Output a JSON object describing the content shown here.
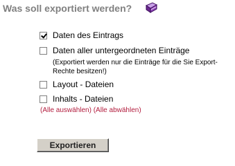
{
  "header": {
    "title": "Was soll exportiert werden?",
    "icon": "book-icon"
  },
  "options": [
    {
      "label": "Daten des Eintrags",
      "checked": true
    },
    {
      "label": "Daten aller untergeordneten Einträge",
      "checked": false
    },
    {
      "label": "Layout - Dateien",
      "checked": false
    },
    {
      "label": "Inhalts - Dateien",
      "checked": false
    }
  ],
  "note": "(Exportiert werden nur die Einträge für die Sie Export-Rechte besitzen!)",
  "links": {
    "select_all": "(Alle auswählen)",
    "deselect_all": "(Alle abwählen)"
  },
  "export_button": "Exportieren",
  "colors": {
    "title": "#808080",
    "link": "#b21c3d",
    "button_face": "#d4d0c8"
  }
}
